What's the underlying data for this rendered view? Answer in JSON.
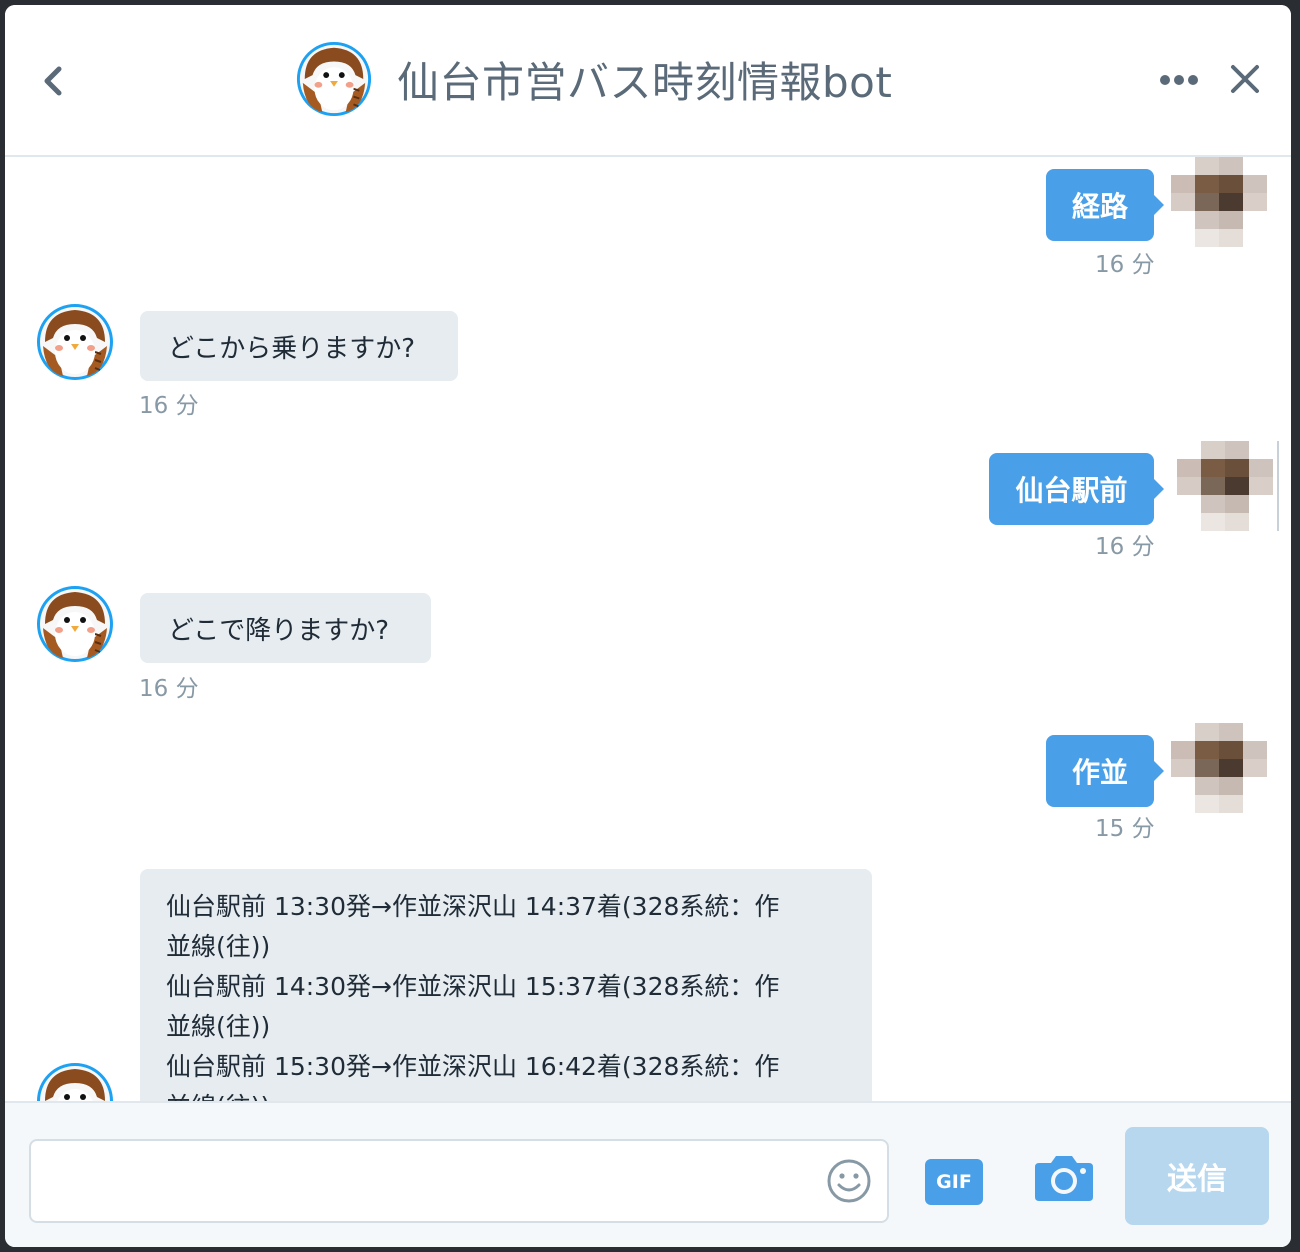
{
  "header": {
    "title": "仙台市営バス時刻情報bot",
    "icons": {
      "back": "chevron-left-icon",
      "more": "more-dots-icon",
      "close": "close-icon",
      "avatar": "owl-avatar"
    }
  },
  "messages": [
    {
      "sender": "me",
      "text": "経路",
      "time": "16 分"
    },
    {
      "sender": "bot",
      "text": "どこから乗りますか?",
      "time": "16 分"
    },
    {
      "sender": "me",
      "text": "仙台駅前",
      "time": "16 分"
    },
    {
      "sender": "bot",
      "text": "どこで降りますか?",
      "time": "16 分"
    },
    {
      "sender": "me",
      "text": "作並",
      "time": "15 分"
    },
    {
      "sender": "bot",
      "lines": [
        "仙台駅前 13:30発→作並深沢山 14:37着(328系統：作",
        "並線(往))",
        "仙台駅前 14:30発→作並深沢山 15:37着(328系統：作",
        "並線(往))",
        "仙台駅前 15:30発→作並深沢山 16:42着(328系統：作",
        "並線(往))"
      ]
    }
  ],
  "composer": {
    "placeholder": "",
    "gif_label": "GIF",
    "send_label": "送信",
    "icons": {
      "emoji": "emoji-icon",
      "camera": "camera-icon"
    }
  },
  "colors": {
    "accent": "#4aa0e8",
    "bot_bubble": "#e6ecf0",
    "send_disabled": "#b7d7ef",
    "timestamp": "#8899a6"
  }
}
